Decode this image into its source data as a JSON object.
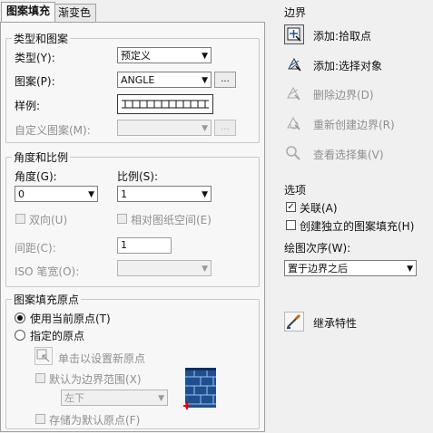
{
  "tabs": [
    "图案填充",
    "渐变色"
  ],
  "type_pattern": {
    "legend": "类型和图案",
    "type_label": "类型(Y):",
    "type_value": "预定义",
    "pattern_label": "图案(P):",
    "pattern_value": "ANGLE",
    "dots": "...",
    "sample_label": "样例:",
    "custom_label": "自定义图案(M):",
    "custom_value": ""
  },
  "angle_scale": {
    "legend": "角度和比例",
    "angle_label": "角度(G):",
    "angle_value": "0",
    "scale_label": "比例(S):",
    "scale_value": "1",
    "double_label": "双向(U)",
    "relative_label": "相对图纸空间(E)",
    "spacing_label": "间距(C):",
    "spacing_value": "1",
    "iso_label": "ISO 笔宽(O):",
    "iso_value": ""
  },
  "origin": {
    "legend": "图案填充原点",
    "use_current": "使用当前原点(T)",
    "specified": "指定的原点",
    "click_set": "单击以设置新原点",
    "default_boundary": "默认为边界范围(X)",
    "position_value": "左下",
    "store_default": "存储为默认原点(F)"
  },
  "boundary": {
    "title": "边界",
    "add_pick": "添加:拾取点",
    "add_select": "添加:选择对象",
    "remove": "删除边界(D)",
    "recreate": "重新创建边界(R)",
    "view_selection": "查看选择集(V)"
  },
  "options": {
    "title": "选项",
    "associative": "关联(A)",
    "separate": "创建独立的图案填充(H)",
    "draw_order_label": "绘图次序(W):",
    "draw_order_value": "置于边界之后"
  },
  "inherit": "继承特性",
  "state": {
    "associative_checked": true,
    "separate_checked": false,
    "use_current_origin": true
  },
  "colors": {
    "accent_blue": "#1e4f8f",
    "disabled_text": "#8f8f8f"
  }
}
